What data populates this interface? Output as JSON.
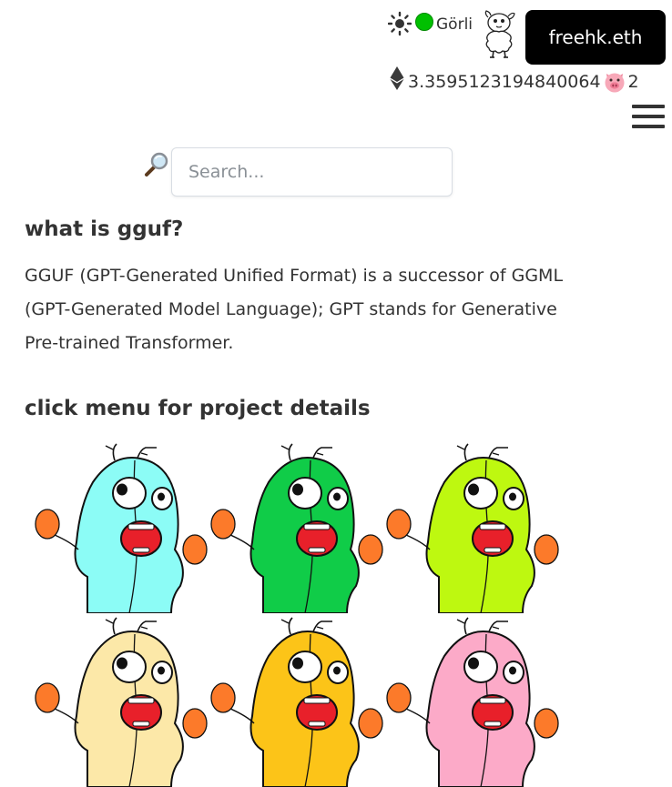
{
  "header": {
    "theme_icon": "sun-icon",
    "network": {
      "status_color": "#00c000",
      "label": "Görli"
    },
    "avatar_icon": "sheep-icon",
    "account_button_label": "freehk.eth",
    "balance": {
      "currency_icon": "ethereum-icon",
      "value": "3.3595123194840064",
      "token_icon": "pig-icon",
      "token_count": "2"
    },
    "menu_icon": "hamburger-menu-icon"
  },
  "search": {
    "icon": "magnifying-glass-icon",
    "placeholder": "Search..."
  },
  "main": {
    "intro_heading": "what is gguf?",
    "intro_text": "GGUF (GPT-Generated Unified Format) is a successor of GGML (GPT-Generated Model Language); GPT stands for Generative Pre-trained Transformer.",
    "menu_heading": "click menu for project details"
  },
  "gophers": [
    {
      "color": "#8cfcf6",
      "icon": "gopher-icon"
    },
    {
      "color": "#10cc48",
      "icon": "gopher-icon"
    },
    {
      "color": "#bef810",
      "icon": "gopher-icon"
    },
    {
      "color": "#fce8a8",
      "icon": "gopher-icon"
    },
    {
      "color": "#fcc418",
      "icon": "gopher-icon"
    },
    {
      "color": "#fcaac8",
      "icon": "gopher-icon"
    }
  ],
  "colors": {
    "gopher_hand": "#fc7a2a",
    "gopher_mouth": "#e8202a",
    "account_button_bg": "#000000"
  }
}
